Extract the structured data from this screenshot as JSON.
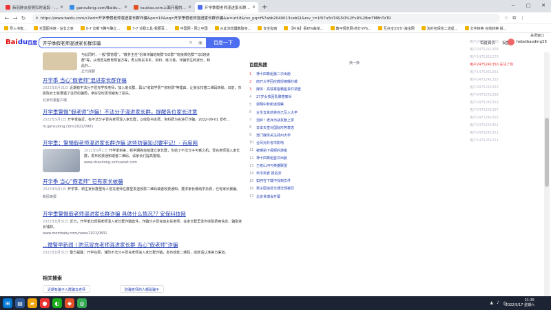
{
  "browser": {
    "tabs": [
      {
        "title": "新冠肺炎疫情实时追踪 - 最新大数据",
        "active": false
      },
      {
        "title": "gansulong.com/Baidu相关资讯",
        "active": false
      },
      {
        "title": "toutiao.com上面开着的 - 排名",
        "active": false
      },
      {
        "title": "开学季假老师混进家长群诈骗_百度搜索",
        "active": true
      }
    ],
    "new_tab": "+",
    "address": "https://www.baidu.com/s?wd=开学季假老师混进家长群诈骗&pn=10&oq=开学季假老师混进家长群诈骗&ie=utf-8&rsv_pq=f67abb2040013cebS1&rsv_t=1f07u5hT4G5O%2FvR%2BmTM8hTzTR",
    "bookmarks": [
      "导入书签...",
      "全国图书馆 - 站长之家",
      "0-7 诊断飞腾与确立...",
      "7-7 诊服工具-我要百...",
      "中国网 - 网上中国",
      "从此浏览器截取身...",
      "安全指南",
      "【补充】看KTV曲单...",
      "教平规范网-统计VPS...",
      "互点宝3万分-海宝网",
      "淘外包保住二流星...",
      "文字转换 在线转换 投..."
    ]
  },
  "baidu": {
    "logo_main": "Bai",
    "logo_blue": "du",
    "logo_cn": "百度",
    "query": "开学季假老师混进家长群诈骗",
    "search_button": "百度一下",
    "topnav": [
      "百度首页",
      "设置"
    ],
    "username": "hebeibaoding25"
  },
  "partial_result": {
    "text": "与此同时，一般\"群管理\"，\"教务主任\"扮演诈骗班级群\"QQ群\"\"班级微信群\"\"QQ班级群\"等，从而冒充教育局官方等，再以购买书本、资料、练习卷，诈骗学生和家长，和此外...",
    "source": "正元成都"
  },
  "results": [
    {
      "title": "开学季 当心\"假老师\"混进家长群诈骗",
      "date": "2022年8月31日",
      "abstract": "近期有不法分子冒充学校老师，加入家长群，再以\"收取学费\"\"资料费\"等理由，让家长扫描二维码转账。日前，市民陈女士就遭遇了这样的骗局，幸好及时发现避免了损失。",
      "source": "北京日报客户端"
    },
    {
      "title": "开学季警惕\"假老师\"诈骗！不法分子混进家长群，提醒各位家长注意",
      "date": "2022年9月1日",
      "abstract": "开学季临近，有不法分子冒充老师混入家长群，以收取书本费、资料费为名进行诈骗。2022-09-01 发布...",
      "source": "m.gansulong.com/2022/0901"
    },
    {
      "title": "开学季：警惕假老师混进家长群诈骗 这些防骗知识要牢记！- 百度网",
      "date": "2022年9月1日",
      "abstract": "开学季到来，新学期各班级建立家长群，也给了不法分子可乘之机。冒充老师混入家长群，发布收费通知或者二维码，请家长们提高警惕。",
      "source": "www.shandong.xinhuanet.com"
    },
    {
      "title": "开学季 当心\"假老师\" 已有家长被骗",
      "date": "2022年9月1日",
      "abstract": "开学季，新生家长群里有人冒充老师在群里发送收款二维码或者收费通知，要求家长缴纳学杂费，已有家长被骗。",
      "source": "新民晚报"
    },
    {
      "title": "开学季警惕假老师混进家长群诈骗 具体什么情况?? 安保科技网",
      "date": "2022年8月31日",
      "abstract": "近日，开学季出现假老师混入家长群诈骗案件。诈骗分子冒充班主任老师，在家长群里发布收取费用信息，骗取家长钱财。",
      "source": "www.mombaby.com/news/2022/0831"
    },
    {
      "title": "...微警早新闻丨防范冒充老师混进家长群 当心\"假老师\"诈骗",
      "date": "2022年8月31日",
      "abstract": "警方提醒：开学在即，谨防不法分子冒充老师进入家长群诈骗，发布收款二维码，收款请认准官方渠道。",
      "source": ""
    }
  ],
  "related": {
    "title": "相关搜索",
    "items": [
      "近期有骗子入群骗去老师",
      "防骗老师的人都是骗子"
    ]
  },
  "hotlist": {
    "title": "百度热搜",
    "refresh": "换一换",
    "items": [
      {
        "num": "1",
        "text": "神十四乘组第二次出舱"
      },
      {
        "num": "2",
        "text": "南开大学回应教授被曝抄袭"
      },
      {
        "num": "3",
        "text": "媒体：高铁乘客霸座事件调查"
      },
      {
        "num": "4",
        "text": "27岁女孩因乳腺癌离世"
      },
      {
        "num": "5",
        "text": "昆明中秋街道观察"
      },
      {
        "num": "6",
        "text": "女生去世前将自己写入大学"
      },
      {
        "num": "7",
        "text": "泪目！老兵为战友献上茶"
      },
      {
        "num": "8",
        "text": "日本天皇对国际形势表态"
      },
      {
        "num": "9",
        "text": "澳门媒体关注郑州大学"
      },
      {
        "num": "10",
        "text": "台风对外省市影响"
      },
      {
        "num": "11",
        "text": "被曝拍下视频的游客"
      },
      {
        "num": "12",
        "text": "神十四乘组首次出舱"
      },
      {
        "num": "13",
        "text": "王者山河与英雄联盟"
      },
      {
        "num": "14",
        "text": "未中奖者 报名去"
      },
      {
        "num": "15",
        "text": "如何在下载中找到文件"
      },
      {
        "num": "16",
        "text": "男子因违反交通法规被罚"
      },
      {
        "num": "17",
        "text": "北京世博会开幕"
      }
    ]
  },
  "side_panel": {
    "rows": [
      "用户2475241358",
      "用户2475241358",
      "用户1475261270",
      "用户2475241350 关注了你",
      "用户1475261251",
      "用户2475241355",
      "用户2475241353",
      "用户2475241359",
      "用户2475241353",
      "用户2475241357",
      "用户2475241353",
      "用户2475241361",
      "用户2475241351",
      "用户1475261251"
    ],
    "float_label": "关闭窗口"
  },
  "taskbar": {
    "time": "21:35",
    "date": "2022/9/17 星期六"
  }
}
